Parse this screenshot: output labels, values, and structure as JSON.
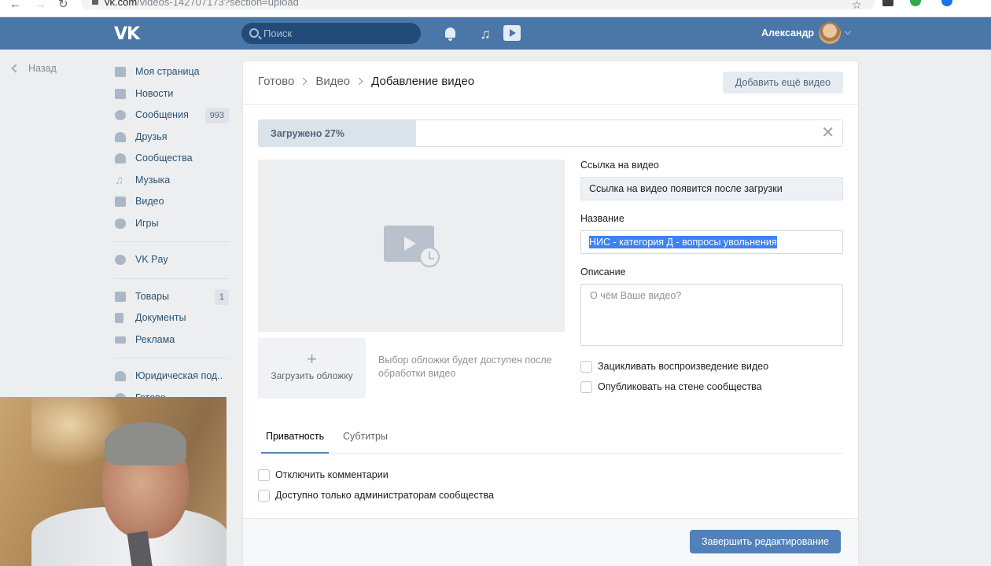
{
  "browser": {
    "url_host": "vk.com",
    "url_path": "/videos-142707173?section=upload"
  },
  "header": {
    "logo": "VK",
    "search_placeholder": "Поиск",
    "user_name": "Александр",
    "colors": {
      "bar": "#4a76a8",
      "search": "#224b7a"
    }
  },
  "back": {
    "label": "Назад"
  },
  "menu": {
    "items": [
      {
        "label": "Моя страница",
        "icon": "home-icon"
      },
      {
        "label": "Новости",
        "icon": "news-icon"
      },
      {
        "label": "Сообщения",
        "icon": "messages-icon",
        "badge": "993"
      },
      {
        "label": "Друзья",
        "icon": "friends-icon"
      },
      {
        "label": "Сообщества",
        "icon": "groups-icon"
      },
      {
        "label": "Музыка",
        "icon": "music-icon"
      },
      {
        "label": "Видео",
        "icon": "video-icon"
      },
      {
        "label": "Игры",
        "icon": "games-icon"
      }
    ],
    "pay": {
      "label": "VK Pay",
      "icon": "vkpay-icon"
    },
    "items2": [
      {
        "label": "Товары",
        "icon": "goods-icon",
        "badge": "1"
      },
      {
        "label": "Документы",
        "icon": "documents-icon"
      },
      {
        "label": "Реклама",
        "icon": "ads-icon"
      }
    ],
    "groups": [
      {
        "label": "Юридическая под..",
        "icon": "group-icon"
      },
      {
        "label": "Готово",
        "icon": "group-icon"
      }
    ]
  },
  "page": {
    "breadcrumb": [
      "Готово",
      "Видео",
      "Добавление видео"
    ],
    "add_more_button": "Добавить ещё видео",
    "progress": {
      "label": "Загружено 27%",
      "value": 0.27
    },
    "cover": {
      "upload_label": "Загрузить обложку",
      "hint": "Выбор обложки будет доступен после обработки видео"
    },
    "fields": {
      "link_label": "Ссылка на видео",
      "link_value": "Ссылка на видео появится после загрузки",
      "title_label": "Название",
      "title_value": "НИС - категория Д - вопросы увольнения",
      "description_label": "Описание",
      "description_placeholder": "О чём Ваше видео?"
    },
    "options": {
      "loop": "Зацикливать воспроизведение видео",
      "publish": "Опубликовать на стене сообщества"
    },
    "tabs": [
      "Приватность",
      "Субтитры"
    ],
    "privacy": {
      "disable_comments": "Отключить комментарии",
      "admins_only": "Доступно только администраторам сообщества"
    },
    "finish_button": "Завершить редактирование",
    "accent": "#5181b8"
  }
}
